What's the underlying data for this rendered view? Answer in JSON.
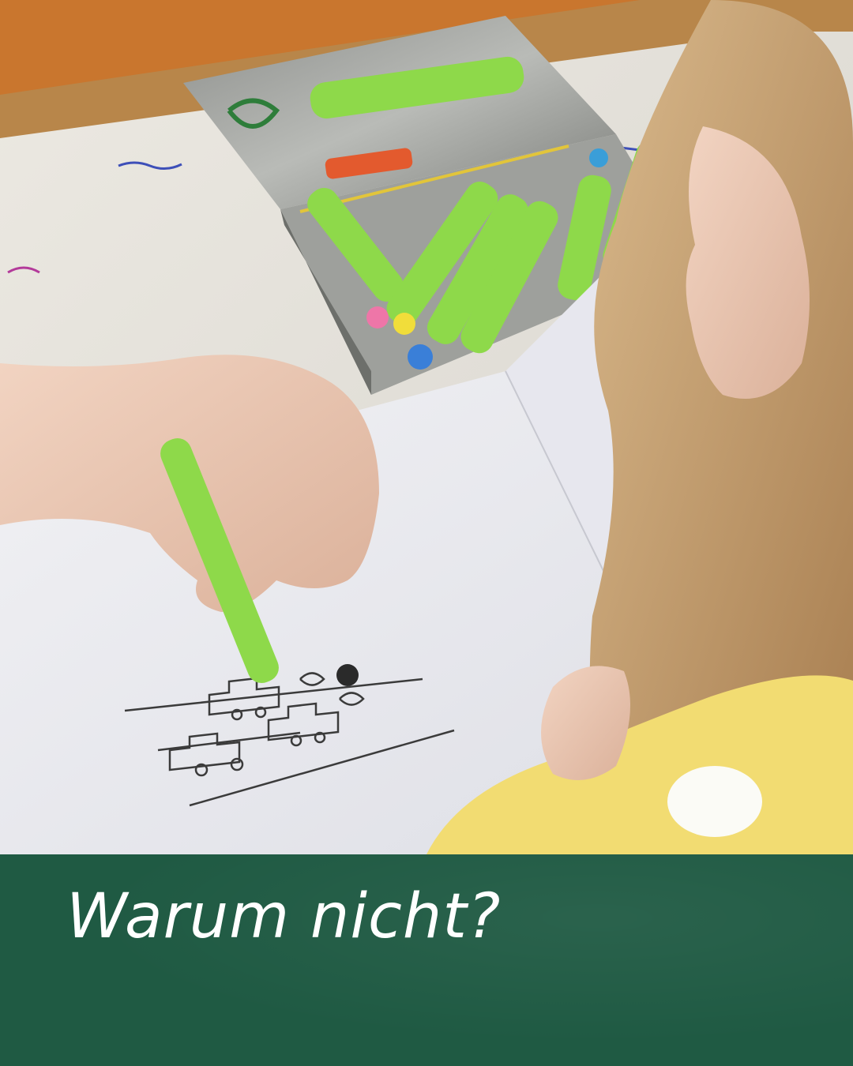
{
  "caption": {
    "text": "Warum nicht?"
  },
  "colors": {
    "caption_bar": "#1f5a43",
    "caption_text": "#ffffff",
    "crayon_green": "#8ed94a"
  }
}
